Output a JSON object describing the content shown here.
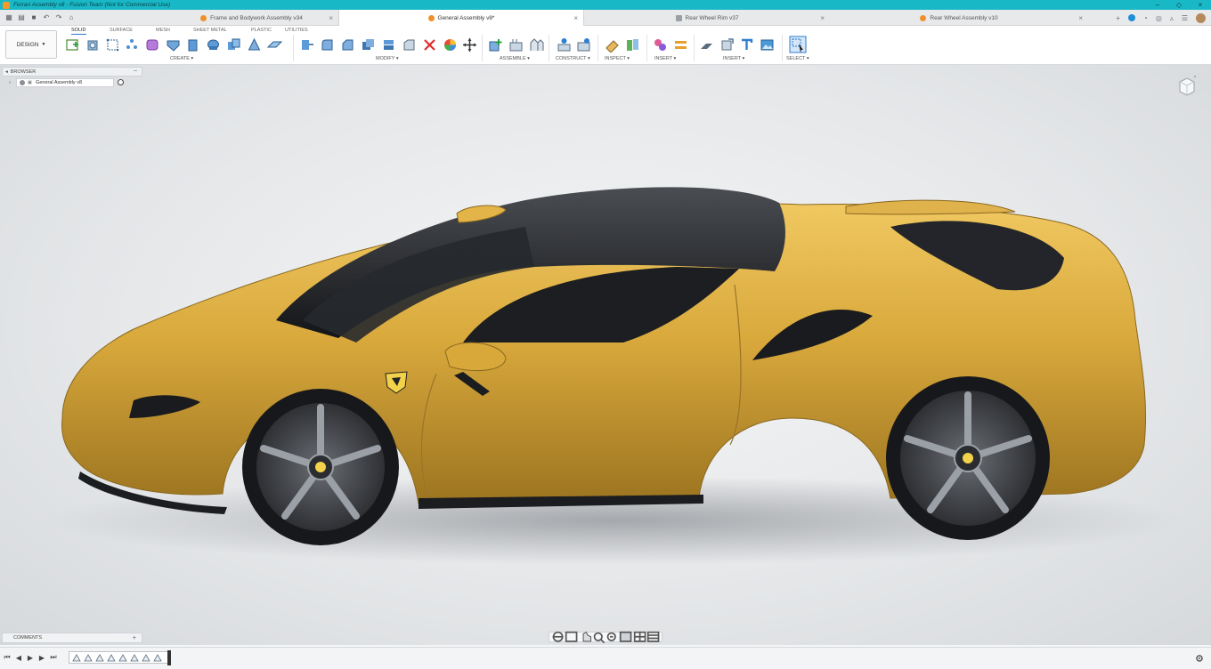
{
  "titlebar": {
    "title": "Ferrari Assembly v8 - Fusion Team (Not for Commercial Use)"
  },
  "quick_access": {
    "grid": "grid-icon",
    "file": "file-icon",
    "save": "save-icon",
    "undo": "undo-icon",
    "redo": "redo-icon",
    "home": "home-icon"
  },
  "tabs": [
    {
      "label": "Frame and Bodywork Assembly v34",
      "icon": "orange-part-icon",
      "active": false
    },
    {
      "label": "General Assembly v8*",
      "icon": "orange-part-icon",
      "active": true
    },
    {
      "label": "Rear Wheel Rim v37",
      "icon": "drawing-icon",
      "active": false
    },
    {
      "label": "Rear Wheel Assembly v10",
      "icon": "orange-part-icon",
      "active": false
    }
  ],
  "toolbar": {
    "workspace_button": "DESIGN",
    "ribbon_tabs": [
      "SOLID",
      "SURFACE",
      "MESH",
      "SHEET METAL",
      "PLASTIC",
      "UTILITIES"
    ],
    "groups": [
      "CREATE",
      "MODIFY",
      "ASSEMBLE",
      "CONSTRUCT",
      "INSPECT",
      "INSERT",
      "SELECT"
    ]
  },
  "browser": {
    "header": "BROWSER",
    "root_label": "General Assembly v8"
  },
  "comments": {
    "label": "COMMENTS"
  },
  "colors": {
    "accent": "#19b8c6",
    "selection": "#2a7bd1",
    "car_body": "#d4a537"
  }
}
